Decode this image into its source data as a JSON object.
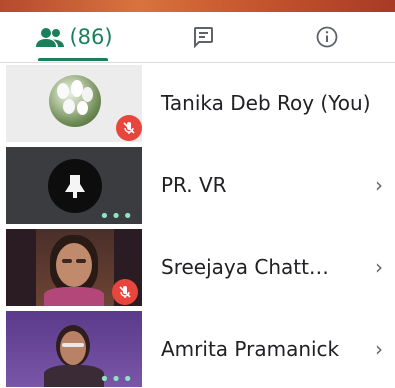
{
  "tabs": {
    "people_count": "(86)",
    "people_icon": "people-icon",
    "chat_icon": "chat-icon",
    "info_icon": "info-icon"
  },
  "participants": [
    {
      "name": "Tanika Deb Roy (You)",
      "muted": true,
      "chevron": ""
    },
    {
      "name": "PR. VR",
      "muted": false,
      "chevron": "›"
    },
    {
      "name": "Sreejaya Chatt…",
      "muted": true,
      "chevron": "›"
    },
    {
      "name": "Amrita Pramanick",
      "muted": false,
      "chevron": "›"
    }
  ],
  "colors": {
    "accent": "#1a7f5a",
    "mute_badge": "#e8453c"
  }
}
